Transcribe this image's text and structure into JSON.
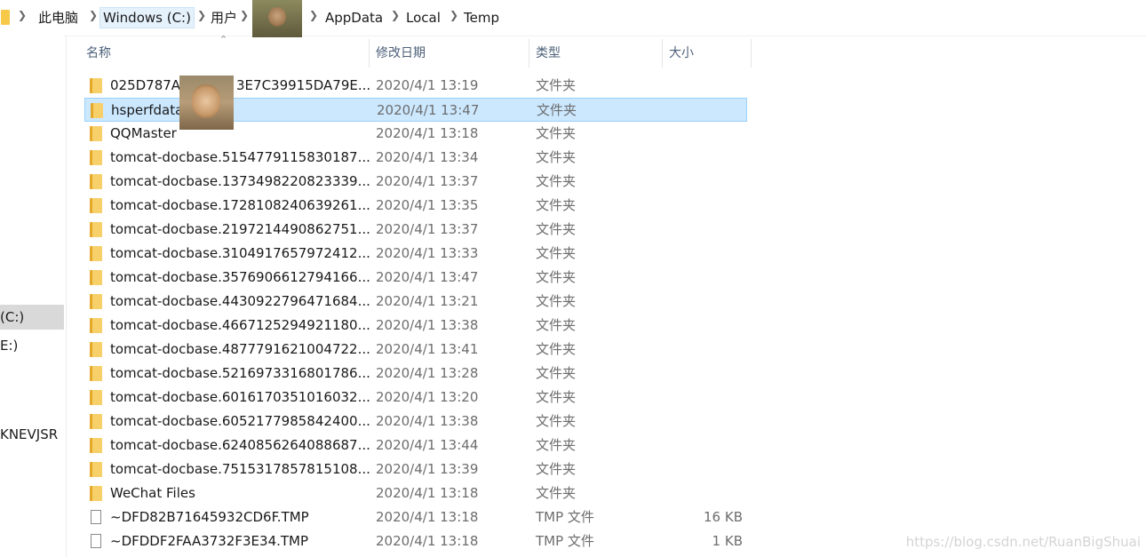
{
  "breadcrumb": {
    "items": [
      "此电脑",
      "Windows (C:)",
      "用户",
      "AppData",
      "Local",
      "Temp"
    ]
  },
  "nav": {
    "items": [
      "(C:)",
      "E:)",
      "KNEVJSR"
    ]
  },
  "columns": {
    "name": "名称",
    "date": "修改日期",
    "type": "类型",
    "size": "大小"
  },
  "rows": [
    {
      "name": "025D787A",
      "name_tail": "3E7C39915DA79E...",
      "date": "2020/4/1 13:19",
      "type": "文件夹",
      "size": "",
      "icon": "folder-icon"
    },
    {
      "name": "hsperfdata",
      "name_tail": "",
      "date": "2020/4/1 13:47",
      "type": "文件夹",
      "size": "",
      "icon": "folder-icon",
      "selected": true
    },
    {
      "name": "QQMaster",
      "name_tail": "",
      "date": "2020/4/1 13:18",
      "type": "文件夹",
      "size": "",
      "icon": "folder-icon"
    },
    {
      "name": "tomcat-docbase.5154779115830187...",
      "name_tail": "",
      "date": "2020/4/1 13:34",
      "type": "文件夹",
      "size": "",
      "icon": "folder-icon"
    },
    {
      "name": "tomcat-docbase.1373498220823339...",
      "name_tail": "",
      "date": "2020/4/1 13:37",
      "type": "文件夹",
      "size": "",
      "icon": "folder-icon"
    },
    {
      "name": "tomcat-docbase.1728108240639261...",
      "name_tail": "",
      "date": "2020/4/1 13:35",
      "type": "文件夹",
      "size": "",
      "icon": "folder-icon"
    },
    {
      "name": "tomcat-docbase.2197214490862751...",
      "name_tail": "",
      "date": "2020/4/1 13:37",
      "type": "文件夹",
      "size": "",
      "icon": "folder-icon"
    },
    {
      "name": "tomcat-docbase.3104917657972412...",
      "name_tail": "",
      "date": "2020/4/1 13:33",
      "type": "文件夹",
      "size": "",
      "icon": "folder-icon"
    },
    {
      "name": "tomcat-docbase.3576906612794166...",
      "name_tail": "",
      "date": "2020/4/1 13:47",
      "type": "文件夹",
      "size": "",
      "icon": "folder-icon"
    },
    {
      "name": "tomcat-docbase.4430922796471684...",
      "name_tail": "",
      "date": "2020/4/1 13:21",
      "type": "文件夹",
      "size": "",
      "icon": "folder-icon"
    },
    {
      "name": "tomcat-docbase.4667125294921180...",
      "name_tail": "",
      "date": "2020/4/1 13:38",
      "type": "文件夹",
      "size": "",
      "icon": "folder-icon"
    },
    {
      "name": "tomcat-docbase.4877791621004722...",
      "name_tail": "",
      "date": "2020/4/1 13:41",
      "type": "文件夹",
      "size": "",
      "icon": "folder-icon"
    },
    {
      "name": "tomcat-docbase.5216973316801786...",
      "name_tail": "",
      "date": "2020/4/1 13:28",
      "type": "文件夹",
      "size": "",
      "icon": "folder-icon"
    },
    {
      "name": "tomcat-docbase.6016170351016032...",
      "name_tail": "",
      "date": "2020/4/1 13:20",
      "type": "文件夹",
      "size": "",
      "icon": "folder-icon"
    },
    {
      "name": "tomcat-docbase.6052177985842400...",
      "name_tail": "",
      "date": "2020/4/1 13:38",
      "type": "文件夹",
      "size": "",
      "icon": "folder-icon"
    },
    {
      "name": "tomcat-docbase.6240856264088687...",
      "name_tail": "",
      "date": "2020/4/1 13:44",
      "type": "文件夹",
      "size": "",
      "icon": "folder-icon"
    },
    {
      "name": "tomcat-docbase.7515317857815108...",
      "name_tail": "",
      "date": "2020/4/1 13:39",
      "type": "文件夹",
      "size": "",
      "icon": "folder-icon"
    },
    {
      "name": "WeChat Files",
      "name_tail": "",
      "date": "2020/4/1 13:18",
      "type": "文件夹",
      "size": "",
      "icon": "folder-icon"
    },
    {
      "name": "~DFD82B71645932CD6F.TMP",
      "name_tail": "",
      "date": "2020/4/1 13:18",
      "type": "TMP 文件",
      "size": "16 KB",
      "icon": "file-icon"
    },
    {
      "name": "~DFDDF2FAA3732F3E34.TMP",
      "name_tail": "",
      "date": "2020/4/1 13:18",
      "type": "TMP 文件",
      "size": "1 KB",
      "icon": "file-icon"
    }
  ],
  "watermark": "https://blog.csdn.net/RuanBigShuai",
  "colors": {
    "selection_bg": "#cce8ff",
    "selection_border": "#99d1ff",
    "folder": "#f8d06a",
    "header_text": "#4c607a"
  }
}
